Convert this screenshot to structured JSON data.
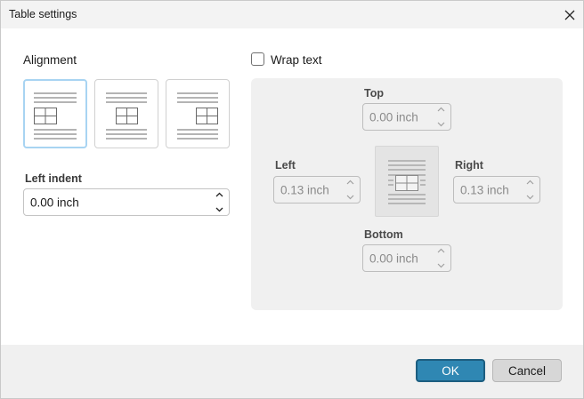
{
  "dialog": {
    "title": "Table settings"
  },
  "alignment": {
    "label": "Alignment",
    "options": [
      "left",
      "center",
      "right"
    ],
    "selected": "left"
  },
  "left_indent": {
    "label": "Left indent",
    "value": "0.00 inch"
  },
  "wrap_text": {
    "label": "Wrap text",
    "checked": false
  },
  "margins": {
    "top": {
      "label": "Top",
      "value": "0.00 inch"
    },
    "left": {
      "label": "Left",
      "value": "0.13 inch"
    },
    "right": {
      "label": "Right",
      "value": "0.13 inch"
    },
    "bottom": {
      "label": "Bottom",
      "value": "0.00 inch"
    }
  },
  "footer": {
    "ok_label": "OK",
    "cancel_label": "Cancel"
  },
  "colors": {
    "accent": "#2f87b3",
    "selected_border": "#a8d4f2"
  }
}
